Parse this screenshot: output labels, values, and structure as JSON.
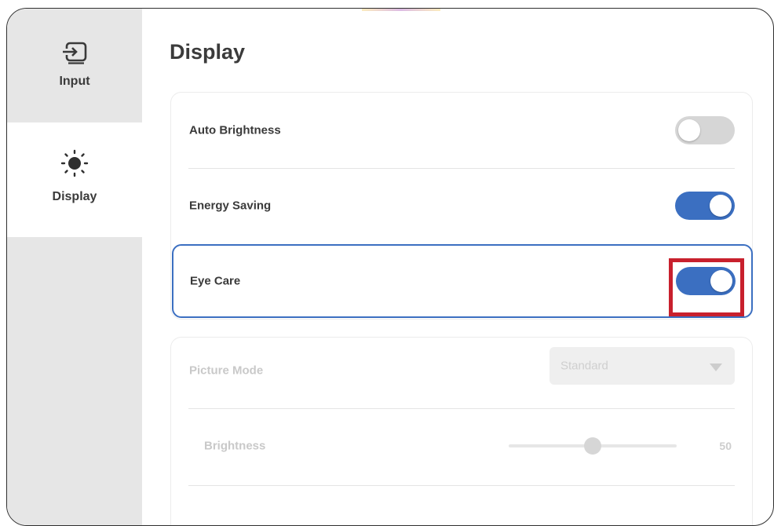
{
  "sidebar": {
    "items": [
      {
        "label": "Input",
        "icon": "input-icon",
        "selected": false
      },
      {
        "label": "Display",
        "icon": "sun-icon",
        "selected": true
      }
    ]
  },
  "page": {
    "title": "Display"
  },
  "settings": {
    "auto_brightness": {
      "label": "Auto Brightness",
      "state": "off"
    },
    "energy_saving": {
      "label": "Energy Saving",
      "state": "on"
    },
    "eye_care": {
      "label": "Eye Care",
      "state": "on",
      "highlighted": true
    }
  },
  "disabled_section": {
    "picture_mode": {
      "label": "Picture Mode",
      "value": "Standard"
    },
    "brightness": {
      "label": "Brightness",
      "value": "50",
      "level": 0.5
    }
  },
  "colors": {
    "accent": "#3b6fc1",
    "highlight": "#c8202d",
    "sidebar_bg": "#e6e6e6"
  }
}
